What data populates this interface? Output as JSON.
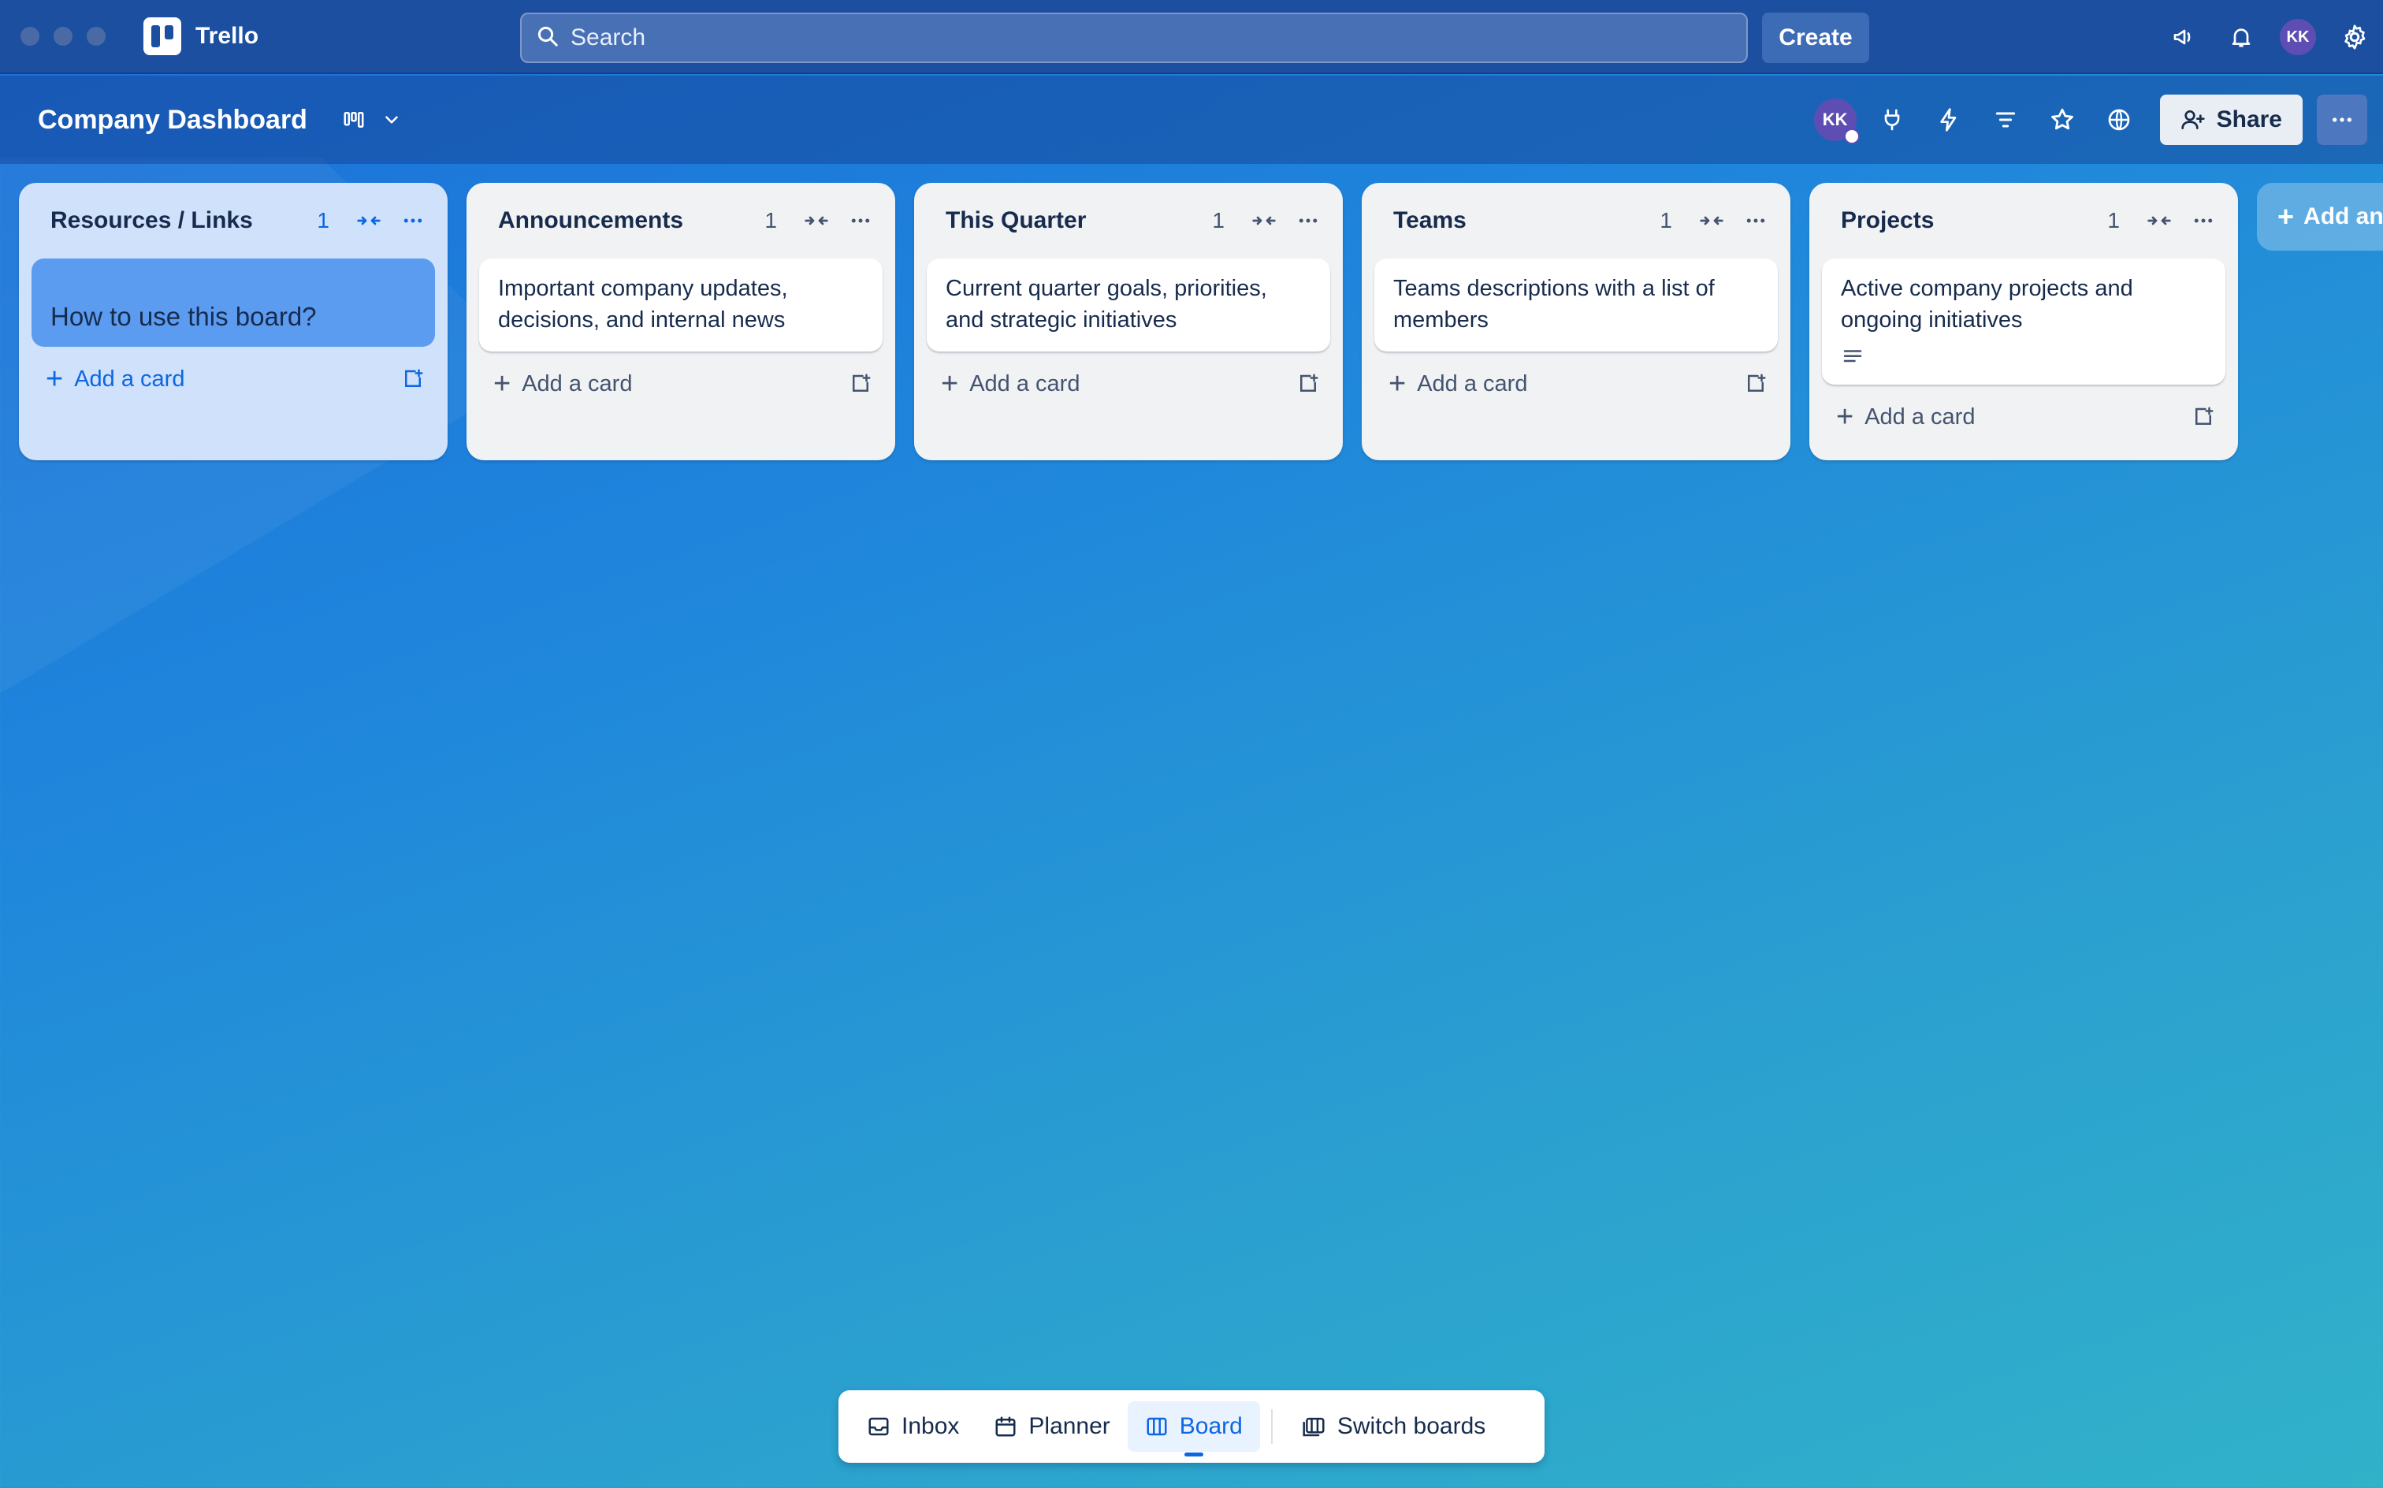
{
  "app": {
    "name": "Trello"
  },
  "topbar": {
    "search_placeholder": "Search",
    "create_label": "Create",
    "avatar_initials": "KK"
  },
  "board": {
    "title": "Company Dashboard",
    "member_initials": "KK",
    "share_label": "Share"
  },
  "lists": [
    {
      "title": "Resources / Links",
      "count": "1",
      "cards": [
        "How to use this board?"
      ],
      "add_label": "Add a card"
    },
    {
      "title": "Announcements",
      "count": "1",
      "cards": [
        "Important company updates, decisions, and internal news"
      ],
      "add_label": "Add a card"
    },
    {
      "title": "This Quarter",
      "count": "1",
      "cards": [
        "Current quarter goals, priorities, and strategic initiatives"
      ],
      "add_label": "Add a card"
    },
    {
      "title": "Teams",
      "count": "1",
      "cards": [
        "Teams descriptions with a list of members"
      ],
      "add_label": "Add a card"
    },
    {
      "title": "Projects",
      "count": "1",
      "cards": [
        "Active company projects and ongoing initiatives"
      ],
      "add_label": "Add a card"
    }
  ],
  "add_list_label": "Add an",
  "bottom_nav": {
    "inbox": "Inbox",
    "planner": "Planner",
    "board": "Board",
    "switch": "Switch boards"
  }
}
